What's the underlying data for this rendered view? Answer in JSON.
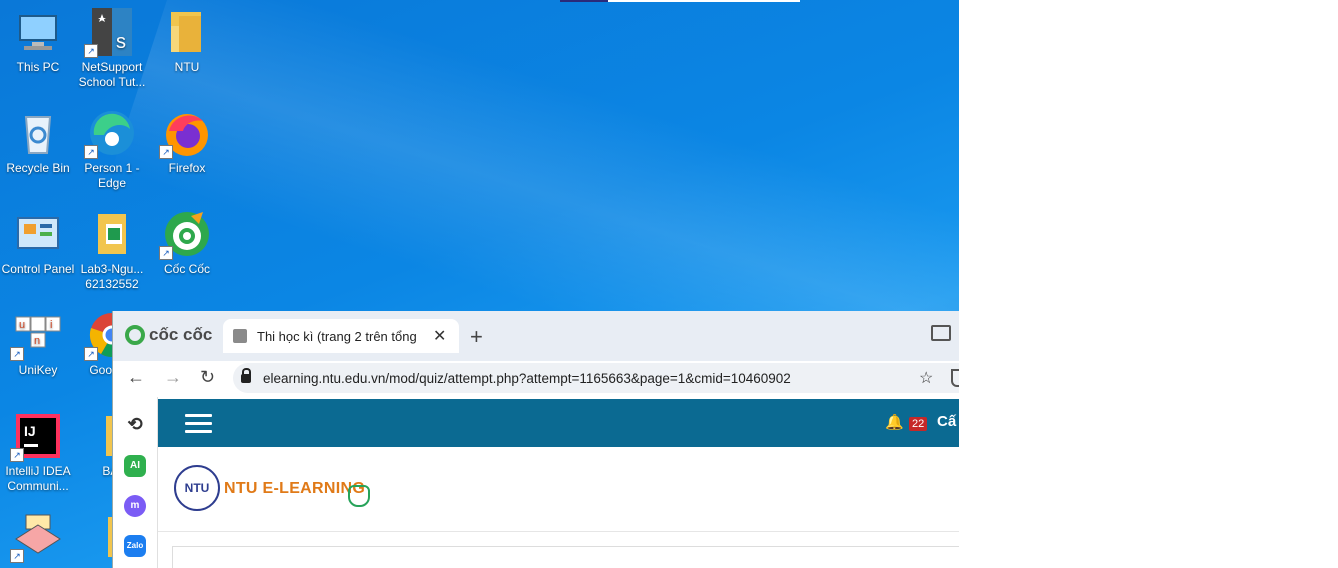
{
  "desktop_icons": [
    {
      "label": "This PC",
      "icon": "computer-icon",
      "shortcut": false
    },
    {
      "label": "NetSupport School Tut...",
      "icon": "netsupport-icon",
      "shortcut": true
    },
    {
      "label": "NTU",
      "icon": "folder-icon",
      "shortcut": false
    },
    {
      "label": "Recycle Bin",
      "icon": "recycle-bin-icon",
      "shortcut": false
    },
    {
      "label": "Person 1 - Edge",
      "icon": "edge-icon",
      "shortcut": true
    },
    {
      "label": "Firefox",
      "icon": "firefox-icon",
      "shortcut": true
    },
    {
      "label": "Control Panel",
      "icon": "control-panel-icon",
      "shortcut": false
    },
    {
      "label": "Lab3-Ngu... 62132552",
      "icon": "excel-folder-icon",
      "shortcut": false
    },
    {
      "label": "Cốc Cốc",
      "icon": "coccoc-icon",
      "shortcut": true
    },
    {
      "label": "UniKey",
      "icon": "unikey-icon",
      "shortcut": true
    },
    {
      "label": "Goo Chr",
      "icon": "chrome-icon",
      "shortcut": true
    },
    {
      "label": "IntelliJ IDEA Communi...",
      "icon": "intellij-icon",
      "shortcut": true
    },
    {
      "label": "BAI",
      "icon": "folder-icon",
      "shortcut": false
    }
  ],
  "browser": {
    "brand": "cốc cốc",
    "tab_title": "Thi học kì (trang 2 trên tổng",
    "tab_close": "✕",
    "new_tab": "+",
    "url": "elearning.ntu.edu.vn/mod/quiz/attempt.php?attempt=1165663&page=1&cmid=10460902",
    "sidebar_items": [
      {
        "name": "history-icon",
        "label": "⟲"
      },
      {
        "name": "ai-icon",
        "label": "AI"
      },
      {
        "name": "messenger-icon",
        "label": "m"
      },
      {
        "name": "zalo-icon",
        "label": "Zalo"
      }
    ]
  },
  "moodle": {
    "notification_count": "22",
    "username": "Cấ",
    "site_logo_text": "NTU E-LEARNING",
    "seal_text": "NTU"
  },
  "colors": {
    "moodle_bar": "#0b6a92",
    "logo_orange": "#e07a18",
    "badge_red": "#c62828"
  }
}
